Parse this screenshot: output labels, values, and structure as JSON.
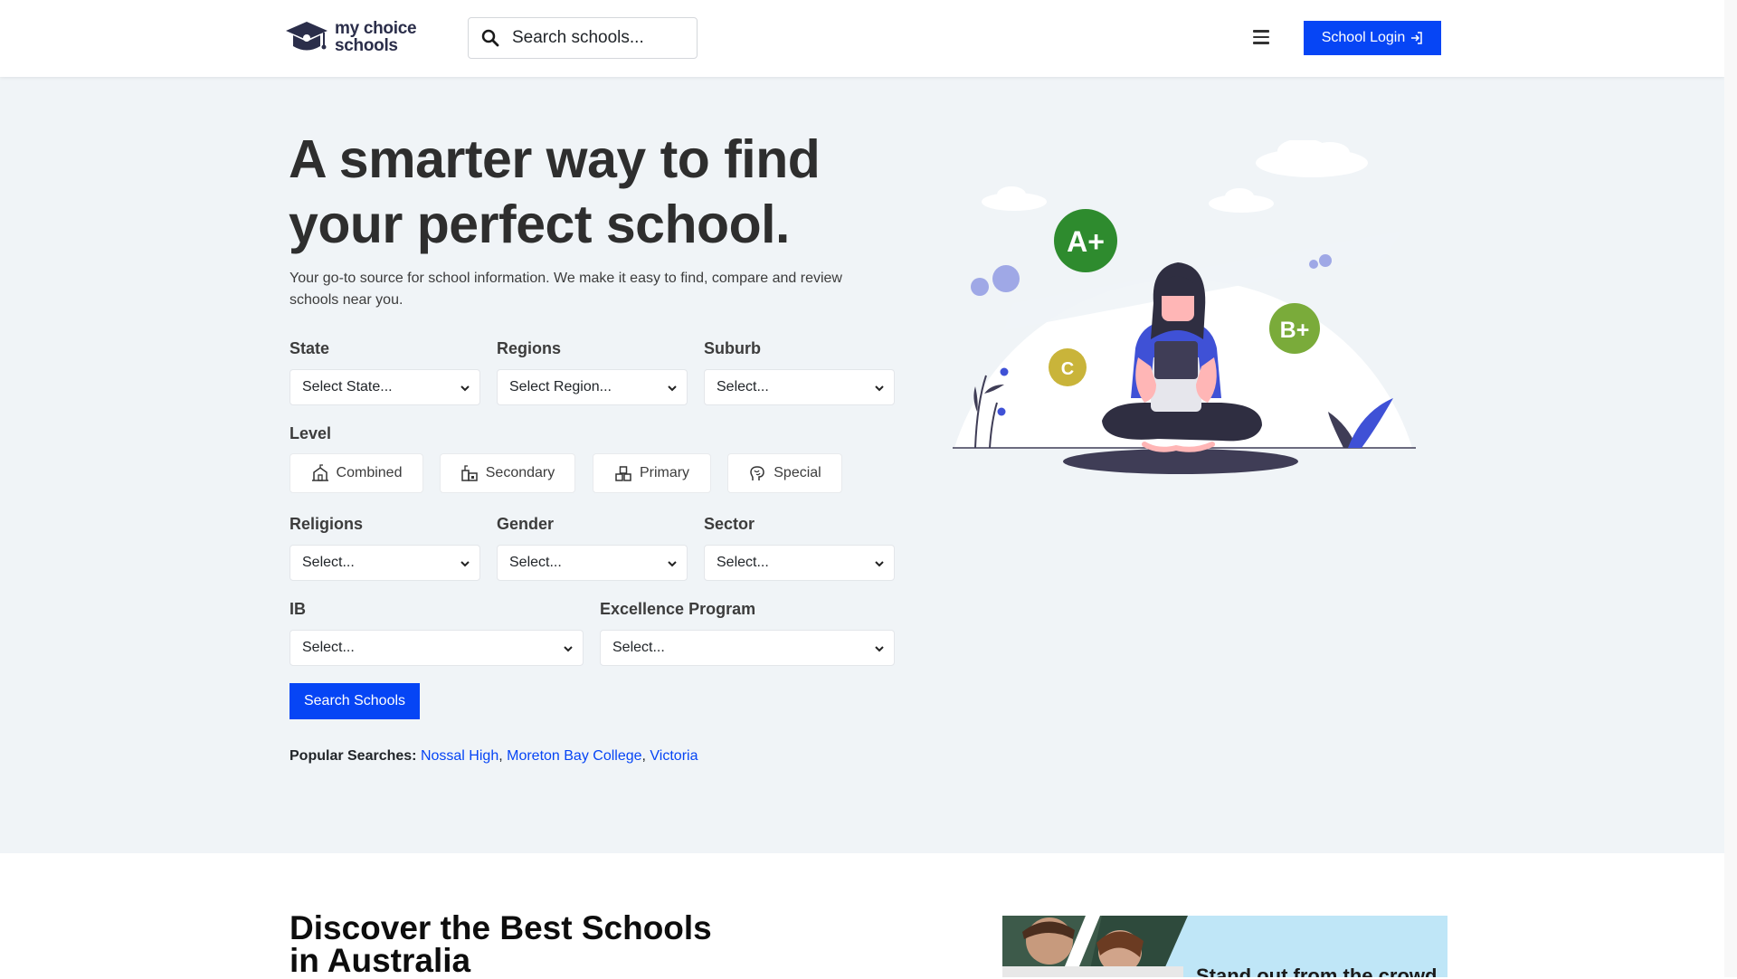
{
  "header": {
    "logo_line1": "my choice",
    "logo_line2": "schools",
    "search_placeholder": "Search schools...",
    "login_label": "School Login"
  },
  "hero": {
    "title_line1": "A smarter way to find",
    "title_line2": "your perfect school.",
    "subtitle_line1": "Your go-to source for school information. We make it easy to find, compare and review",
    "subtitle_line2": "schools near you.",
    "filters": {
      "state_label": "State",
      "state_value": "Select State...",
      "regions_label": "Regions",
      "regions_value": "Select Region...",
      "suburb_label": "Suburb",
      "suburb_value": "Select...",
      "level_label": "Level",
      "levels": [
        "Combined",
        "Secondary",
        "Primary",
        "Special"
      ],
      "religions_label": "Religions",
      "religions_value": "Select...",
      "gender_label": "Gender",
      "gender_value": "Select...",
      "sector_label": "Sector",
      "sector_value": "Select...",
      "ib_label": "IB",
      "ib_value": "Select...",
      "excellence_label": "Excellence Program",
      "excellence_value": "Select..."
    },
    "search_button": "Search Schools",
    "popular_label": "Popular Searches:",
    "popular_links": [
      "Nossal High",
      "Moreton Bay College",
      "Victoria"
    ],
    "grades": [
      "A+",
      "B+",
      "C"
    ]
  },
  "discover": {
    "title_line1": "Discover the Best Schools",
    "title_line2": "in Australia",
    "banner_text": "Stand out from the crowd"
  },
  "colors": {
    "primary": "#0645f5",
    "hero_bg": "#f0f4f7",
    "grade_a": "#2e8b2e",
    "grade_b": "#7aab3a",
    "grade_c": "#c9b43a",
    "illustration_accent": "#3f51d6"
  }
}
